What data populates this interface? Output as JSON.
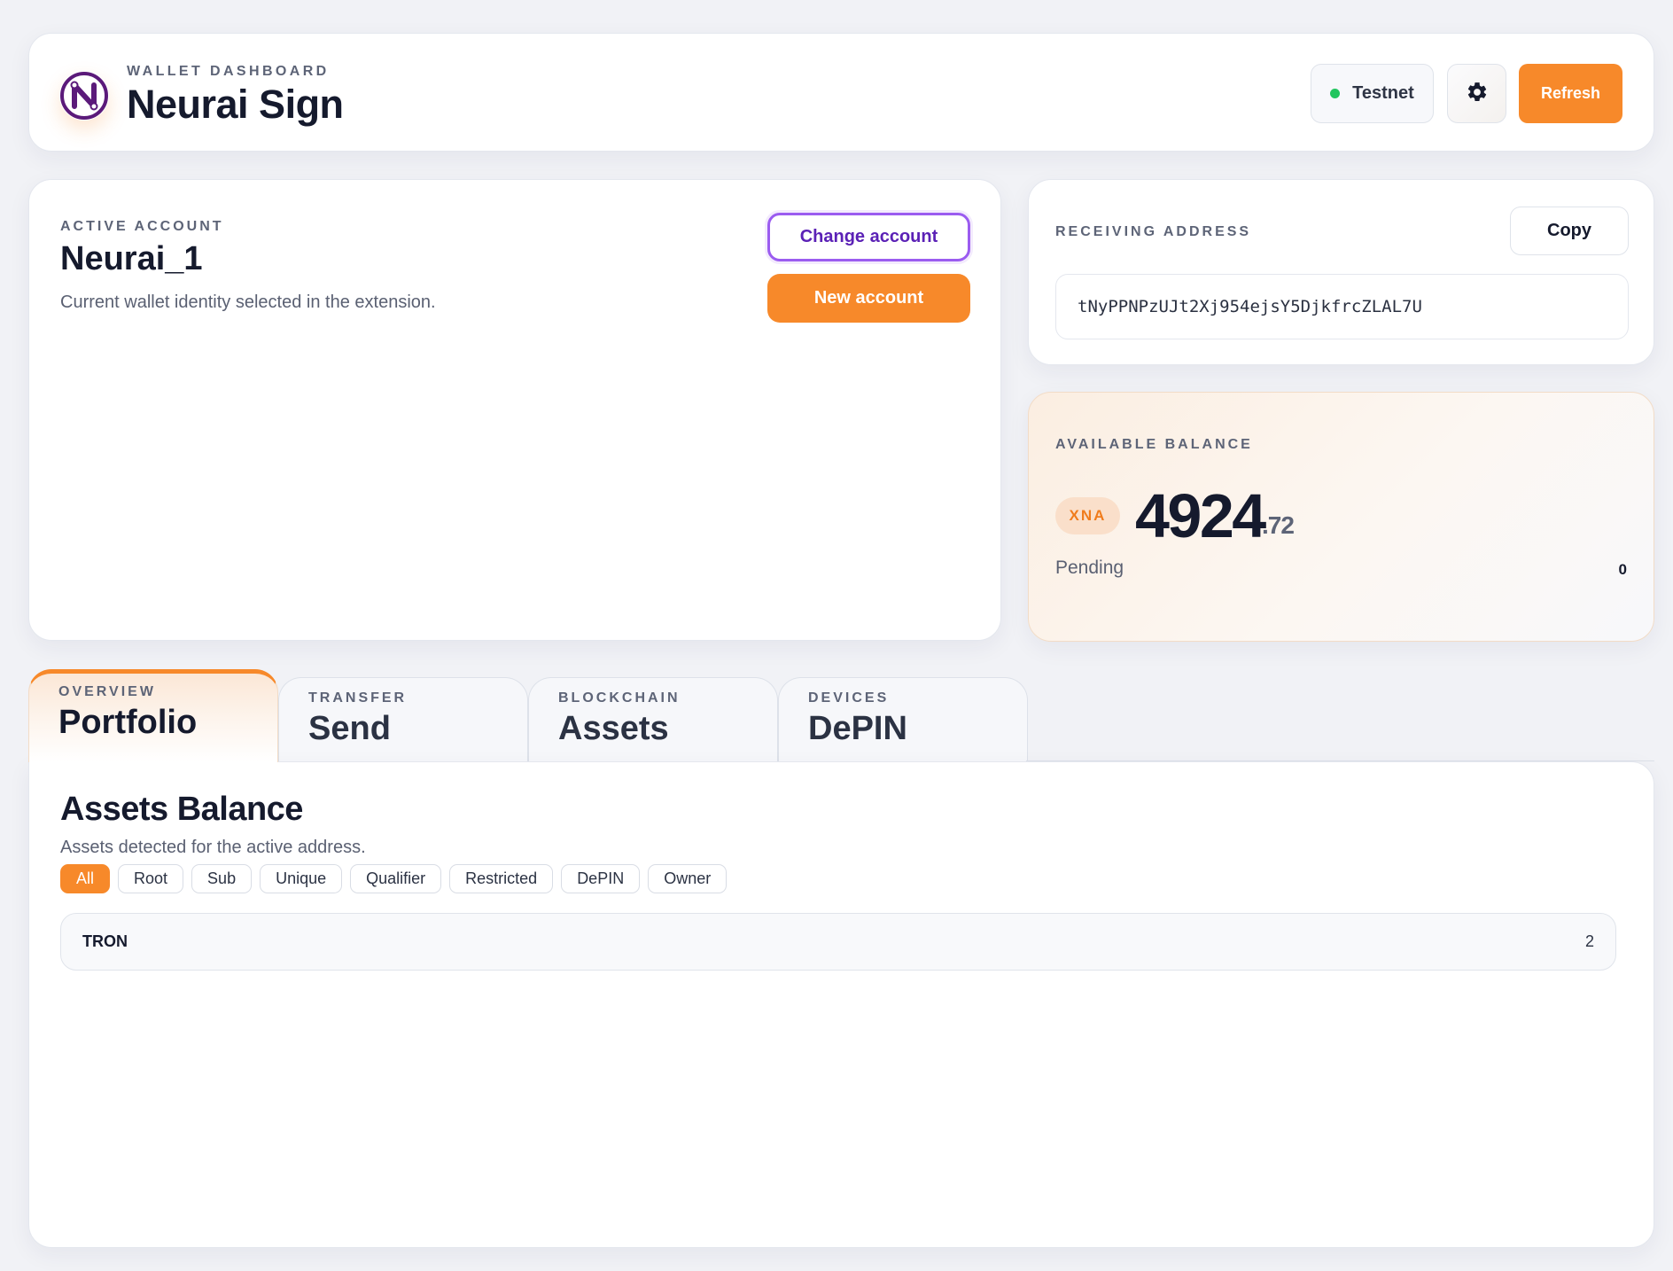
{
  "header": {
    "kicker": "WALLET DASHBOARD",
    "title": "Neurai Sign",
    "network": "Testnet",
    "refresh_label": "Refresh"
  },
  "icons": {
    "logo": "neurai-logo-icon",
    "network_status": "status-dot-icon",
    "settings": "gear-icon"
  },
  "colors": {
    "accent": "#f7892a",
    "purple": "#9b5cf0",
    "status_online": "#22c55e"
  },
  "account": {
    "kicker": "ACTIVE ACCOUNT",
    "name": "Neurai_1",
    "description": "Current wallet identity selected in the extension.",
    "change_label": "Change account",
    "new_label": "New account"
  },
  "address": {
    "kicker": "RECEIVING ADDRESS",
    "copy_label": "Copy",
    "value": "tNyPPNPzUJt2Xj954ejsY5DjkfrcZLAL7U"
  },
  "balance": {
    "kicker": "AVAILABLE BALANCE",
    "currency": "XNA",
    "integer": "4924",
    "decimal": ".72",
    "pending_label": "Pending",
    "pending_value": "0"
  },
  "tabs": [
    {
      "kicker": "OVERVIEW",
      "label": "Portfolio",
      "active": true
    },
    {
      "kicker": "TRANSFER",
      "label": "Send",
      "active": false
    },
    {
      "kicker": "BLOCKCHAIN",
      "label": "Assets",
      "active": false
    },
    {
      "kicker": "DEVICES",
      "label": "DePIN",
      "active": false
    }
  ],
  "assets": {
    "title": "Assets Balance",
    "description": "Assets detected for the active address.",
    "filters": [
      "All",
      "Root",
      "Sub",
      "Unique",
      "Qualifier",
      "Restricted",
      "DePIN",
      "Owner"
    ],
    "active_filter": "All",
    "rows": [
      {
        "name": "TRON",
        "quantity": "2"
      }
    ]
  }
}
